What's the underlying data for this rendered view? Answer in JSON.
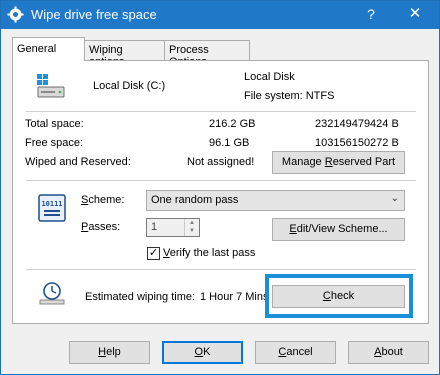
{
  "window": {
    "title": "Wipe drive free space",
    "help": "?",
    "close": "✕"
  },
  "tabs": [
    {
      "label": "General"
    },
    {
      "label": "Wiping options"
    },
    {
      "label": "Process Options"
    }
  ],
  "drive": {
    "name": "Local Disk (C:)",
    "type_label": "Local Disk",
    "filesystem": "File system: NTFS"
  },
  "stats": {
    "total_label": "Total space:",
    "total_value": "216.2 GB",
    "total_bytes": "232149479424 B",
    "free_label": "Free space:",
    "free_value": "96.1 GB",
    "free_bytes": "103156150272 B",
    "reserved_label": "Wiped and Reserved:",
    "reserved_value": "Not assigned!"
  },
  "buttons": {
    "manage_reserved": {
      "pre": "Manage ",
      "u": "R",
      "post": "eserved Part"
    },
    "edit_scheme": {
      "pre": "",
      "u": "E",
      "post": "dit/View Scheme..."
    },
    "check": {
      "pre": "",
      "u": "C",
      "post": "heck"
    },
    "help": {
      "pre": "",
      "u": "H",
      "post": "elp"
    },
    "ok": {
      "pre": "",
      "u": "O",
      "post": "K"
    },
    "cancel": {
      "pre": "",
      "u": "C",
      "post": "ancel"
    },
    "about": {
      "pre": "",
      "u": "A",
      "post": "bout"
    }
  },
  "scheme": {
    "label_u": "S",
    "label_rest": "cheme:",
    "value": "One random pass",
    "passes_label_u": "P",
    "passes_label_rest": "asses:",
    "passes_value": "1",
    "verify_u": "V",
    "verify_rest": "erify the last pass",
    "verify_checked": true
  },
  "estimate": {
    "label": "Estimated wiping time:",
    "value": "1 Hour 7 Mins"
  },
  "icons": {
    "app": "gear-icon",
    "drive": "hard-drive-icon",
    "scheme": "binary-chip-icon",
    "timer": "clock-icon"
  },
  "colors": {
    "titlebar": "#1f78c8",
    "highlight": "#1a8fd6"
  }
}
